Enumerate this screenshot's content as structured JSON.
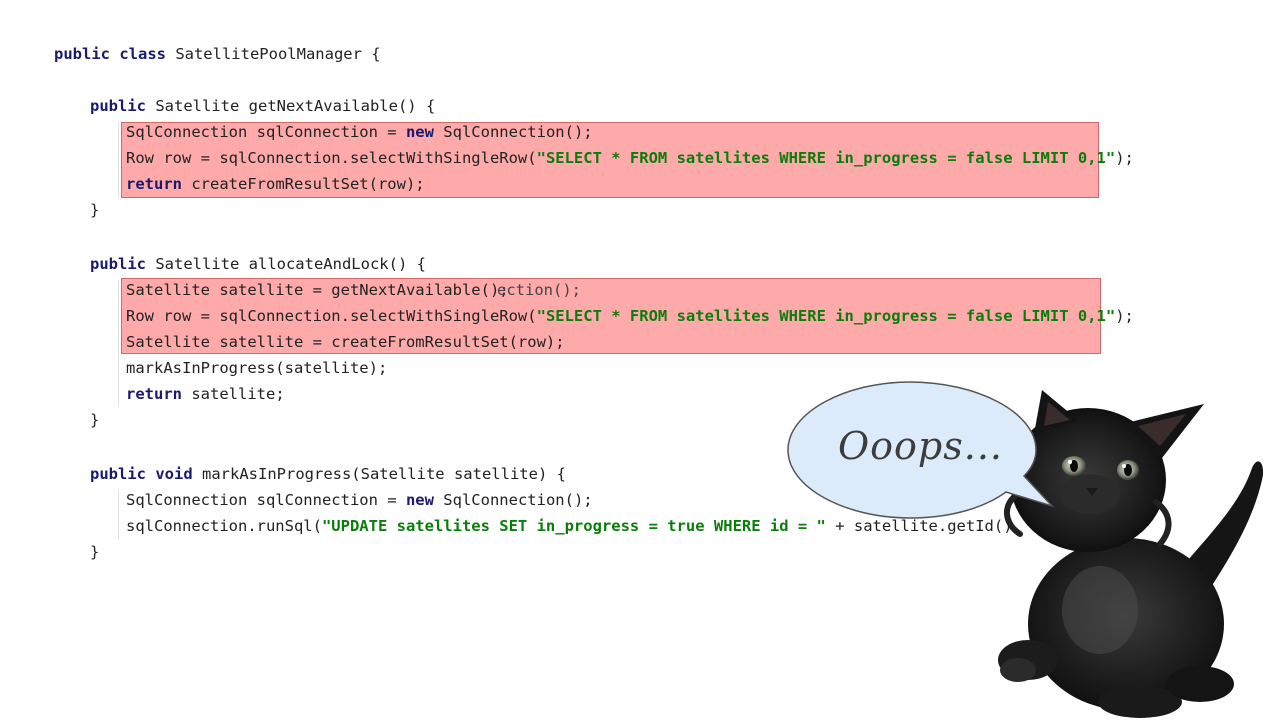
{
  "code": {
    "class_decl": {
      "kw": "public class",
      "rest": " SatellitePoolManager {"
    },
    "method1": {
      "sig_kw": "public",
      "sig_rest": " Satellite getNextAvailable() {",
      "line1_a": "SqlConnection sqlConnection = ",
      "line1_kw": "new",
      "line1_b": " SqlConnection();",
      "line2_a": "Row row = sqlConnection.selectWithSingleRow(",
      "line2_str": "\"SELECT * FROM satellites WHERE in_progress = false LIMIT 0,1\"",
      "line2_b": ");",
      "line3_kw": "return",
      "line3_b": " createFromResultSet(row);",
      "close": "}"
    },
    "method2": {
      "sig_kw": "public",
      "sig_rest": " Satellite allocateAndLock() {",
      "line1_a": "Satellite satellite = getNextAvailable();",
      "line1_ghost": "ection();",
      "line2_a": "Row row = sqlConnection.selectWithSingleRow(",
      "line2_str": "\"SELECT * FROM satellites WHERE in_progress = false LIMIT 0,1\"",
      "line2_b": ");",
      "line3_a": "Satellite satellite = createFromResultSet(row);",
      "line4_a": "markAsInProgress(satellite);",
      "line5_kw": "return",
      "line5_b": " satellite;",
      "close": "}"
    },
    "method3": {
      "sig_kw1": "public",
      "sig_kw2": "void",
      "sig_rest": " markAsInProgress(Satellite satellite) {",
      "line1_a": "SqlConnection sqlConnection = ",
      "line1_kw": "new",
      "line1_b": " SqlConnection();",
      "line2_a": "sqlConnection.runSql(",
      "line2_str": "\"UPDATE satellites SET in_progress = true WHERE id = \"",
      "line2_b": " + satellite.getId()",
      "close": "}"
    }
  },
  "bubble": {
    "text": "Ooops..."
  },
  "illustration": {
    "subject": "kitten-icon"
  },
  "colors": {
    "keyword": "#1a1a6e",
    "string": "#0a7d0a",
    "highlight_fill": "#ffaaaa",
    "highlight_border": "#d06a6a"
  }
}
